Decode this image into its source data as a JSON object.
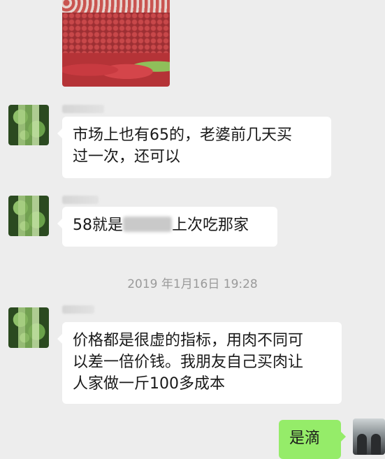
{
  "messages": [
    {
      "type": "image",
      "side": "left",
      "description_icon": "meat-photo"
    },
    {
      "type": "text",
      "side": "left",
      "text_line1": "市场上也有65的，老婆前几天买",
      "text_line2": "过一次，还可以"
    },
    {
      "type": "text",
      "side": "left",
      "text_before": "58就是",
      "text_after": "上次吃那家"
    },
    {
      "type": "text",
      "side": "left",
      "text_line1": "价格都是很虚的指标，用肉不同可",
      "text_line2": "以差一倍价钱。我朋友自己买肉让",
      "text_line3": "人家做一斤100多成本"
    },
    {
      "type": "text",
      "side": "right",
      "text": "是滴"
    }
  ],
  "timestamp": "2019 年1月16日 19:28",
  "colors": {
    "background": "#ededed",
    "incoming_bubble": "#ffffff",
    "outgoing_bubble": "#95ec69",
    "timestamp_text": "#9a9a9a"
  }
}
